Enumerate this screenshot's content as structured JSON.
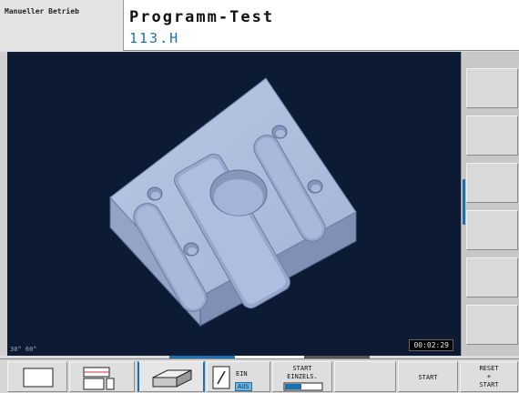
{
  "header": {
    "mode_label": "Manueller Betrieb",
    "program_title": "Programm-Test",
    "program_file": "113.H"
  },
  "viewport": {
    "view_angles": "30°  60°",
    "elapsed_time": "00:02:29"
  },
  "softkeys_bottom": {
    "toggle_on": "EIN",
    "toggle_off": "AUS",
    "start_single_line1": "START",
    "start_single_line2": "EINZELS.",
    "start": "START",
    "reset_line1": "RESET",
    "reset_line2": "+",
    "reset_line3": "START"
  },
  "colors": {
    "accent": "#1a6fb0",
    "viewport_bg": "#0d1a33",
    "workpiece": "#a8b8d8"
  },
  "icons": [
    "view-single-icon",
    "view-plan-elevation-icon",
    "view-3d-block-icon",
    "block-slash-icon",
    "start-single-list-icon"
  ]
}
